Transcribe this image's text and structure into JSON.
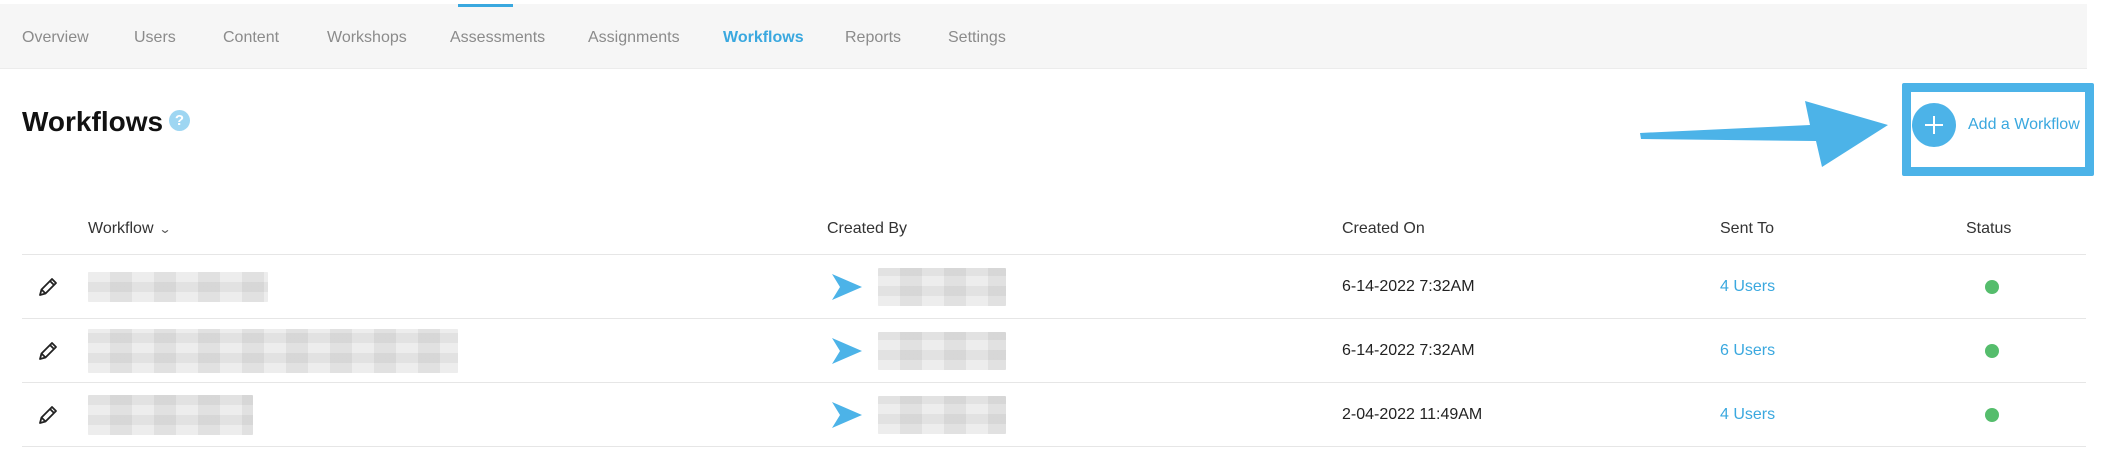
{
  "nav": {
    "tabs": [
      {
        "label": "Overview"
      },
      {
        "label": "Users"
      },
      {
        "label": "Content"
      },
      {
        "label": "Workshops"
      },
      {
        "label": "Assessments"
      },
      {
        "label": "Assignments"
      },
      {
        "label": "Workflows",
        "active": true
      },
      {
        "label": "Reports"
      },
      {
        "label": "Settings"
      }
    ]
  },
  "header": {
    "title": "Workflows",
    "help_icon": "?",
    "add_button_label": "Add a Workflow"
  },
  "table": {
    "columns": {
      "workflow": "Workflow",
      "created_by": "Created By",
      "created_on": "Created On",
      "sent_to": "Sent To",
      "status": "Status"
    },
    "rows": [
      {
        "created_on": "6-14-2022 7:32AM",
        "sent_to": "4 Users",
        "status": "active"
      },
      {
        "created_on": "6-14-2022 7:32AM",
        "sent_to": "6 Users",
        "status": "active"
      },
      {
        "created_on": "2-04-2022 11:49AM",
        "sent_to": "4 Users",
        "status": "active"
      }
    ]
  },
  "colors": {
    "accent": "#3aa8df",
    "status_active": "#55bd6c",
    "annotation": "#4cb3e8"
  },
  "icons": [
    "help-icon",
    "plus-icon",
    "chevron-down-icon",
    "pencil-icon",
    "user-avatar-icon",
    "status-dot"
  ]
}
